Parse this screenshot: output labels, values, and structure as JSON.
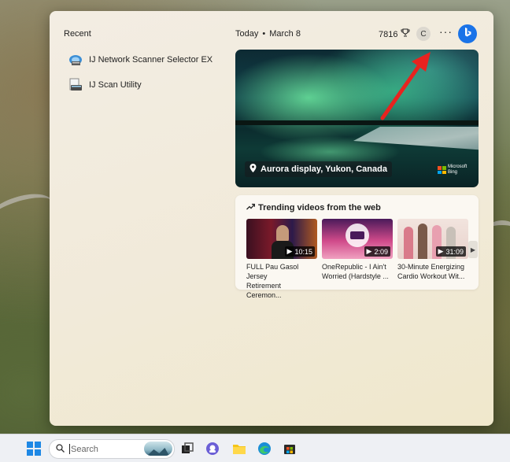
{
  "widgets": {
    "recent": {
      "title": "Recent",
      "items": [
        {
          "label": "IJ Network Scanner Selector EX",
          "icon": "network-scanner-icon"
        },
        {
          "label": "IJ Scan Utility",
          "icon": "scan-utility-icon"
        }
      ]
    },
    "header": {
      "today": "Today",
      "separator": "•",
      "date": "March 8",
      "points": "7816",
      "points_icon": "trophy-icon",
      "avatar_initial": "C",
      "more_label": "···"
    },
    "hero": {
      "caption": "Aurora display, Yukon, Canada",
      "location_icon": "location-pin-icon",
      "brand_line1": "Microsoft",
      "brand_line2": "Bing"
    },
    "trending": {
      "title": "Trending videos from the web",
      "videos": [
        {
          "title_line1": "FULL Pau Gasol Jersey",
          "title_line2": "Retirement Ceremon...",
          "duration": "10:15"
        },
        {
          "title_line1": "OneRepublic - I Ain't",
          "title_line2": "Worried (Hardstyle ...",
          "duration": "2:09"
        },
        {
          "title_line1": "30-Minute Energizing",
          "title_line2": "Cardio Workout Wit...",
          "duration": "31:09"
        }
      ]
    }
  },
  "taskbar": {
    "search_placeholder": "Search",
    "icons": [
      "windows-start-icon",
      "search-icon",
      "task-view-icon",
      "chat-icon",
      "file-explorer-icon",
      "edge-icon",
      "store-icon"
    ]
  },
  "colors": {
    "accent": "#1a73e8",
    "arrow": "#e8231f",
    "panel": "#f2ecdf"
  }
}
